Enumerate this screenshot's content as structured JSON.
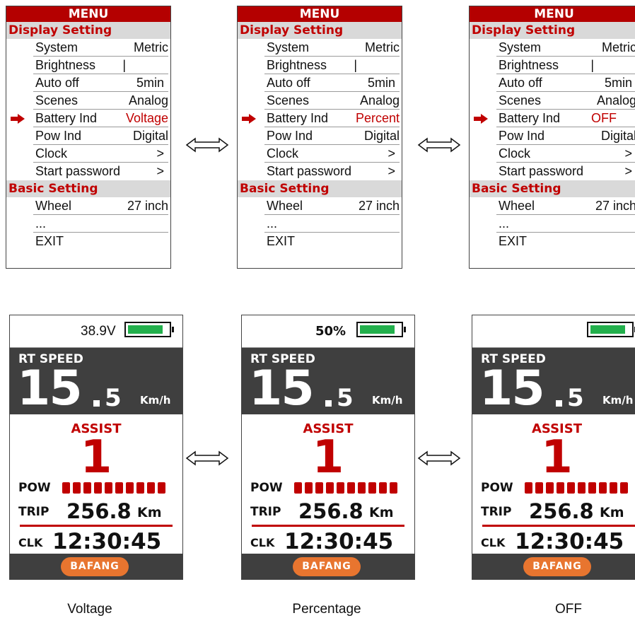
{
  "menu": {
    "title": "MENU",
    "display_section": "Display Setting",
    "basic_section": "Basic Setting",
    "rows": {
      "system": {
        "label": "System",
        "value": "Metric"
      },
      "brightness": {
        "label": "Brightness",
        "value": "|"
      },
      "auto_off": {
        "label": "Auto off",
        "value": "5min"
      },
      "scenes": {
        "label": "Scenes",
        "value": "Analog"
      },
      "battery_ind": {
        "label": "Battery Ind"
      },
      "pow_ind": {
        "label": "Pow Ind",
        "value": "Digital"
      },
      "clock": {
        "label": "Clock",
        "value": ">"
      },
      "start_password": {
        "label": "Start password",
        "value": ">"
      },
      "wheel": {
        "label": "Wheel",
        "value": "27 inch"
      },
      "more": {
        "label": "..."
      },
      "exit": {
        "label": "EXIT"
      }
    },
    "battery_values": [
      "Voltage",
      "Percent",
      "OFF"
    ]
  },
  "display": {
    "battery_texts": [
      "38.9V",
      "50%",
      ""
    ],
    "battery_level": 0.9,
    "speed_label": "RT SPEED",
    "speed_int": "15",
    "speed_dec": "5",
    "speed_unit": "Km/h",
    "assist_label": "ASSIST",
    "assist_level": "1",
    "pow_label": "POW",
    "pow_segments": 10,
    "trip_label": "TRIP",
    "trip_value": "256.8",
    "trip_unit": "Km",
    "clk_label": "CLK",
    "clk_value": "12:30:45",
    "logo": "BAFANG"
  },
  "captions": [
    "Voltage",
    "Percentage",
    "OFF"
  ],
  "colors": {
    "accent_red": "#c00000",
    "battery_green": "#22b04c",
    "dark_panel": "#3f3f3f",
    "logo_orange": "#e8752f"
  }
}
